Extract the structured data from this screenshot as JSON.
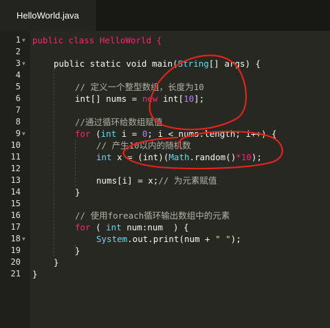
{
  "tab": {
    "title": "HelloWorld.java"
  },
  "line_numbers": [
    "1",
    "2",
    "3",
    "4",
    "5",
    "6",
    "7",
    "8",
    "9",
    "10",
    "11",
    "12",
    "13",
    "14",
    "15",
    "16",
    "17",
    "18",
    "19",
    "20",
    "21"
  ],
  "fold_markers": {
    "1": "▼",
    "3": "▼",
    "9": "▼",
    "17": "▼"
  },
  "code": {
    "l1_a": "public class HelloWorld {",
    "l3_a": "public static void main(",
    "l3_b": "String",
    "l3_c": "[] args) {",
    "l5_a": "// 定义一个整型数组，长度为10",
    "l6_a": "int[] nums = ",
    "l6_b": "new",
    "l6_c": " int[",
    "l6_d": "10",
    "l6_e": "];",
    "l8_a": "//通过循环给数组赋值",
    "l9_a": "for",
    "l9_b": " (",
    "l9_c": "int",
    "l9_d": " i = ",
    "l9_e": "0",
    "l9_f": "; i < nums.length; i++) {",
    "l10_a": "// 产生10以内的随机数",
    "l11_a": "int",
    "l11_b": " x = (int)(",
    "l11_c": "Math",
    "l11_d": ".random()",
    "l11_e": "*10",
    "l11_f": ");",
    "l13_a": "nums[i] = x;",
    "l13_b": "// 为元素赋值",
    "l14_a": "}",
    "l16_a": "// 使用foreach循环输出数组中的元素",
    "l17_a": "for",
    "l17_b": " ( ",
    "l17_c": "int",
    "l17_d": " num:num  ) {",
    "l18_a": "System",
    "l18_b": ".out.print(num + ",
    "l18_c": "\" \"",
    "l18_d": ");",
    "l19_a": "}",
    "l20_a": "}",
    "l21_a": "}"
  },
  "colors": {
    "background": "#272822",
    "keyword": "#f92672",
    "type": "#66d9ef",
    "number": "#ae81ff",
    "string": "#e6db74",
    "comment": "#b2b2a8",
    "annotation_ink": "#e3241b"
  }
}
